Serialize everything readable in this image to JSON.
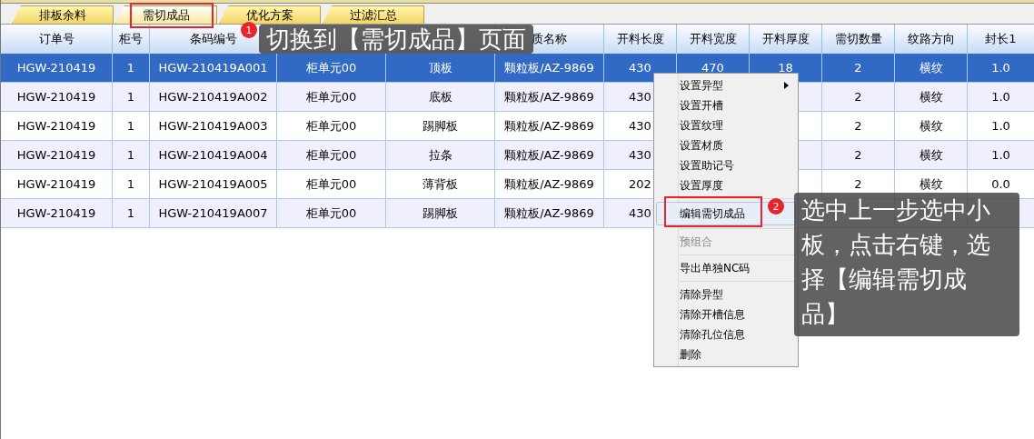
{
  "tabs": [
    {
      "label": "排板余料",
      "selected": false
    },
    {
      "label": "需切成品",
      "selected": true
    },
    {
      "label": "优化方案",
      "selected": false
    },
    {
      "label": "过滤汇总",
      "selected": false
    }
  ],
  "table": {
    "columns": [
      "订单号",
      "柜号",
      "条码编号",
      null,
      null,
      "质名称",
      "开料长度",
      "开料宽度",
      "开料厚度",
      "需切数量",
      "纹路方向",
      "封长1"
    ],
    "rows": [
      {
        "selected": true,
        "cells": [
          "HGW-210419",
          "1",
          "HGW-210419A001",
          "柜单元00",
          "顶板",
          "颗粒板/AZ-9869",
          "430",
          "470",
          "18",
          "2",
          "横纹",
          "1.0"
        ]
      },
      {
        "selected": false,
        "cells": [
          "HGW-210419",
          "1",
          "HGW-210419A002",
          "柜单元00",
          "底板",
          "颗粒板/AZ-9869",
          "430",
          null,
          null,
          "2",
          "横纹",
          "1.0"
        ]
      },
      {
        "selected": false,
        "cells": [
          "HGW-210419",
          "1",
          "HGW-210419A003",
          "柜单元00",
          "踢脚板",
          "颗粒板/AZ-9869",
          "430",
          null,
          null,
          "2",
          "横纹",
          "1.0"
        ]
      },
      {
        "selected": false,
        "cells": [
          "HGW-210419",
          "1",
          "HGW-210419A004",
          "柜单元00",
          "拉条",
          "颗粒板/AZ-9869",
          "430",
          null,
          null,
          "2",
          "横纹",
          "1.0"
        ]
      },
      {
        "selected": false,
        "cells": [
          "HGW-210419",
          "1",
          "HGW-210419A005",
          "柜单元00",
          "薄背板",
          "颗粒板/AZ-9869",
          "202",
          null,
          null,
          "2",
          "横纹",
          "0.0"
        ]
      },
      {
        "selected": false,
        "cells": [
          "HGW-210419",
          "1",
          "HGW-210419A007",
          "柜单元00",
          "踢脚板",
          "颗粒板/AZ-9869",
          "430",
          null,
          null,
          null,
          null,
          null
        ]
      }
    ]
  },
  "context_menu": {
    "items": [
      {
        "kind": "item",
        "label": "设置异型",
        "submenu": true,
        "disabled": false,
        "selected": false
      },
      {
        "kind": "item",
        "label": "设置开槽",
        "submenu": false,
        "disabled": false,
        "selected": false
      },
      {
        "kind": "item",
        "label": "设置纹理",
        "submenu": false,
        "disabled": false,
        "selected": false
      },
      {
        "kind": "item",
        "label": "设置材质",
        "submenu": false,
        "disabled": false,
        "selected": false
      },
      {
        "kind": "item",
        "label": "设置助记号",
        "submenu": false,
        "disabled": false,
        "selected": false
      },
      {
        "kind": "item",
        "label": "设置厚度",
        "submenu": false,
        "disabled": false,
        "selected": false
      },
      {
        "kind": "separator"
      },
      {
        "kind": "item",
        "label": "编辑需切成品",
        "submenu": false,
        "disabled": false,
        "selected": true
      },
      {
        "kind": "separator"
      },
      {
        "kind": "item",
        "label": "预组合",
        "submenu": false,
        "disabled": true,
        "selected": false
      },
      {
        "kind": "separator"
      },
      {
        "kind": "item",
        "label": "导出单独NC码",
        "submenu": false,
        "disabled": false,
        "selected": false
      },
      {
        "kind": "separator"
      },
      {
        "kind": "item",
        "label": "清除异型",
        "submenu": false,
        "disabled": false,
        "selected": false
      },
      {
        "kind": "item",
        "label": "清除开槽信息",
        "submenu": false,
        "disabled": false,
        "selected": false
      },
      {
        "kind": "item",
        "label": "清除孔位信息",
        "submenu": false,
        "disabled": false,
        "selected": false
      },
      {
        "kind": "item",
        "label": "删除",
        "submenu": false,
        "disabled": false,
        "selected": false
      }
    ]
  },
  "callouts": [
    {
      "number": "1",
      "text": "切换到【需切成品】页面"
    },
    {
      "number": "2",
      "text": "选中上一步选中小板，点击右键，选择【编辑需切成品】"
    }
  ]
}
